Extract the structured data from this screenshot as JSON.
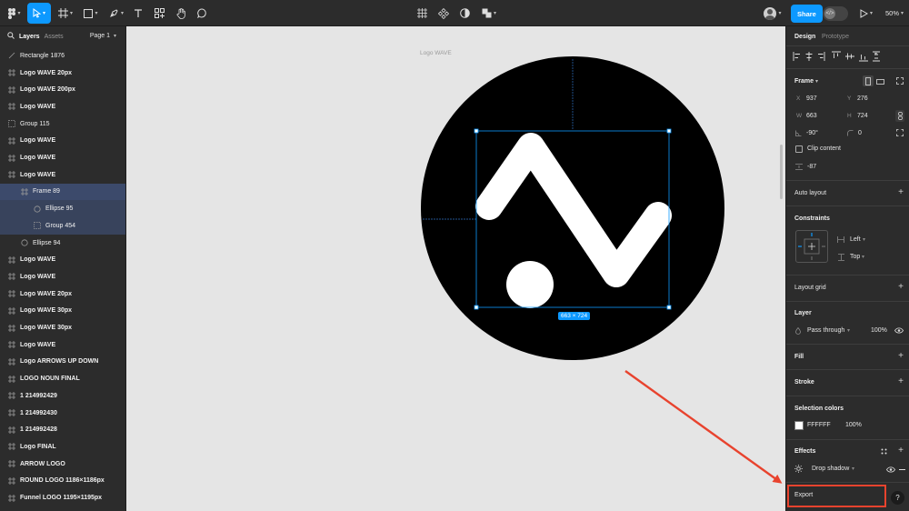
{
  "page": {
    "frame_name": "Logo WAVE",
    "selection_size": "663 × 724"
  },
  "left_panel": {
    "tabs": [
      {
        "label": "Layers"
      },
      {
        "label": "Assets"
      }
    ],
    "page_selector": "Page 1",
    "layers": [
      {
        "label": "Rectangle 1876",
        "icon": "rectangle-icon"
      },
      {
        "label": "Logo WAVE 20px",
        "icon": "frame-icon"
      },
      {
        "label": "Logo WAVE 200px",
        "icon": "frame-icon"
      },
      {
        "label": "Logo WAVE",
        "icon": "frame-icon"
      },
      {
        "label": "Group 115",
        "icon": "group-icon"
      },
      {
        "label": "Logo WAVE",
        "icon": "frame-icon"
      },
      {
        "label": "Logo WAVE",
        "icon": "frame-icon"
      },
      {
        "label": "Logo WAVE",
        "icon": "frame-icon"
      },
      {
        "label": "Frame 89",
        "icon": "frame-icon"
      },
      {
        "label": "Ellipse 95",
        "icon": "ellipse-icon"
      },
      {
        "label": "Group 454",
        "icon": "group-icon"
      },
      {
        "label": "Ellipse 94",
        "icon": "ellipse-icon"
      },
      {
        "label": "Logo WAVE",
        "icon": "frame-icon"
      },
      {
        "label": "Logo WAVE",
        "icon": "frame-icon"
      },
      {
        "label": "Logo WAVE 20px",
        "icon": "frame-icon"
      },
      {
        "label": "Logo WAVE 30px",
        "icon": "frame-icon"
      },
      {
        "label": "Logo WAVE 30px",
        "icon": "frame-icon"
      },
      {
        "label": "Logo WAVE",
        "icon": "frame-icon"
      },
      {
        "label": "Logo ARROWS UP DOWN",
        "icon": "frame-icon"
      },
      {
        "label": "LOGO NOUN FINAL",
        "icon": "frame-icon"
      },
      {
        "label": "1 214992429",
        "icon": "frame-icon"
      },
      {
        "label": "1 214992430",
        "icon": "frame-icon"
      },
      {
        "label": "1 214992428",
        "icon": "frame-icon"
      },
      {
        "label": "Logo FINAL",
        "icon": "frame-icon"
      },
      {
        "label": "ARROW LOGO",
        "icon": "frame-icon"
      },
      {
        "label": "ROUND LOGO 1186×1186px",
        "icon": "frame-icon"
      },
      {
        "label": "Funnel LOGO 1195×1195px",
        "icon": "frame-icon"
      }
    ]
  },
  "toolbar": {
    "share_label": "Share",
    "zoom": "50%"
  },
  "right_panel": {
    "tabs": [
      {
        "label": "Design"
      },
      {
        "label": "Prototype"
      }
    ],
    "frame": {
      "title": "Frame",
      "x_label": "X",
      "x": "937",
      "y_label": "Y",
      "y": "276",
      "w_label": "W",
      "w": "663",
      "h_label": "H",
      "h": "724",
      "rotation": "-90°",
      "radius": "0",
      "clip_content": "Clip content",
      "spacing": "-87"
    },
    "auto_layout": "Auto layout",
    "constraints": {
      "title": "Constraints",
      "horizontal": "Left",
      "vertical": "Top"
    },
    "layout_grid": "Layout grid",
    "layer": {
      "title": "Layer",
      "blend": "Pass through",
      "opacity": "100%"
    },
    "fill": "Fill",
    "stroke": "Stroke",
    "selection_colors": {
      "title": "Selection colors",
      "hex": "FFFFFF",
      "opacity": "100%",
      "swatch_color": "#ffffff"
    },
    "effects": {
      "title": "Effects",
      "item": "Drop shadow"
    },
    "export": "Export",
    "help": "?"
  },
  "colors": {
    "accent": "#0d99ff",
    "annotation": "#e8432e"
  }
}
